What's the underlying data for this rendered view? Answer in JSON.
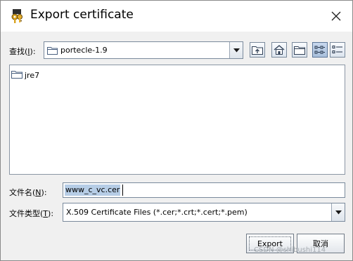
{
  "window": {
    "title": "Export certificate",
    "close_glyph": "✕"
  },
  "look_in": {
    "label": "查找(",
    "mnemonic": "I",
    "label_end": "):",
    "value": "portecle-1.9"
  },
  "toolbar": {
    "buttons": [
      {
        "name": "up-one-level-button",
        "icon": "folder-up-icon"
      },
      {
        "name": "home-button",
        "icon": "home-icon"
      },
      {
        "name": "new-folder-button",
        "icon": "new-folder-icon"
      },
      {
        "name": "list-view-button",
        "icon": "list-view-icon",
        "active": true
      },
      {
        "name": "details-view-button",
        "icon": "details-view-icon"
      }
    ]
  },
  "files": [
    {
      "name": "jre7",
      "icon": "folder-icon"
    }
  ],
  "file_name": {
    "label": "文件名(",
    "mnemonic": "N",
    "label_end": "):",
    "value": "www_c_vc.cer"
  },
  "file_type": {
    "label": "文件类型(",
    "mnemonic": "T",
    "label_end": "):",
    "value": "X.509 Certificate Files (*.cer;*.crt;*.cert;*.pem)"
  },
  "buttons": {
    "export": "Export",
    "cancel": "取消"
  },
  "watermark": "CSDN @shibushi114",
  "colors": {
    "selection": "#b6cde6",
    "dialog_bg": "#f0f0f0",
    "active_toggle": "#a9c0dc"
  }
}
